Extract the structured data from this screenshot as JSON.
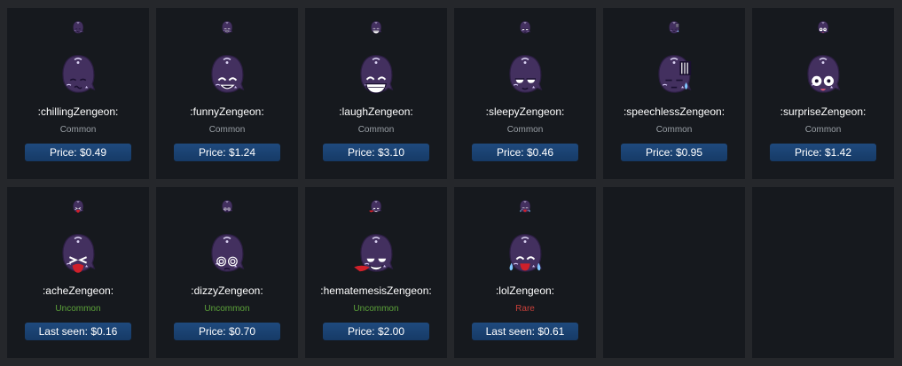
{
  "items": [
    {
      "name": ":chillingZengeon:",
      "rarity": "Common",
      "price": "Price: $0.49",
      "face": "chilling"
    },
    {
      "name": ":funnyZengeon:",
      "rarity": "Common",
      "price": "Price: $1.24",
      "face": "funny"
    },
    {
      "name": ":laughZengeon:",
      "rarity": "Common",
      "price": "Price: $3.10",
      "face": "laugh"
    },
    {
      "name": ":sleepyZengeon:",
      "rarity": "Common",
      "price": "Price: $0.46",
      "face": "sleepy"
    },
    {
      "name": ":speechlessZengeon:",
      "rarity": "Common",
      "price": "Price: $0.95",
      "face": "speechless"
    },
    {
      "name": ":surpriseZengeon:",
      "rarity": "Common",
      "price": "Price: $1.42",
      "face": "surprise"
    },
    {
      "name": ":acheZengeon:",
      "rarity": "Uncommon",
      "price": "Last seen: $0.16",
      "face": "ache"
    },
    {
      "name": ":dizzyZengeon:",
      "rarity": "Uncommon",
      "price": "Price: $0.70",
      "face": "dizzy"
    },
    {
      "name": ":hematemesisZengeon:",
      "rarity": "Uncommon",
      "price": "Price: $2.00",
      "face": "hematemesis"
    },
    {
      "name": ":lolZengeon:",
      "rarity": "Rare",
      "price": "Last seen: $0.61",
      "face": "lol"
    }
  ],
  "colors": {
    "common": "#9aa0a6",
    "uncommon": "#5da43a",
    "rare": "#c8403a",
    "button": "#1f4a7e",
    "card": "#16191e"
  }
}
